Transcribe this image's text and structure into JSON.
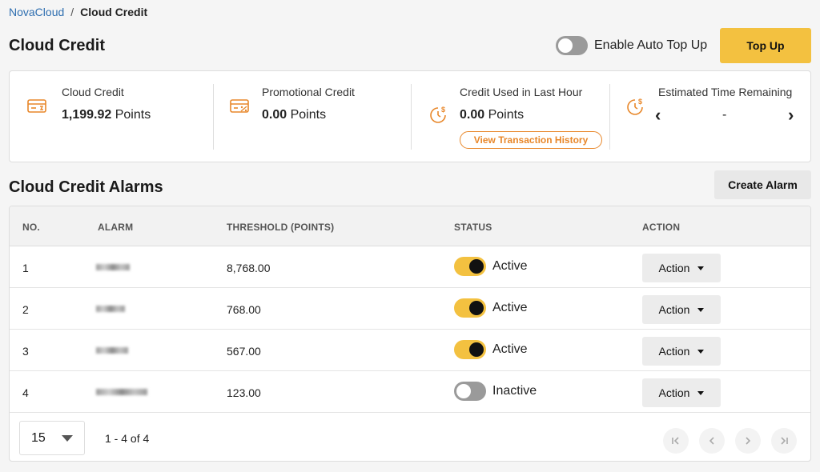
{
  "breadcrumb": {
    "root": "NovaCloud",
    "separator": "/",
    "current": "Cloud Credit"
  },
  "header": {
    "title": "Cloud Credit",
    "auto_topup_label": "Enable Auto Top Up",
    "auto_topup_enabled": false,
    "topup_label": "Top Up"
  },
  "summary": {
    "cloud_credit": {
      "title": "Cloud Credit",
      "amount": "1,199.92",
      "unit": "Points"
    },
    "promotional_credit": {
      "title": "Promotional Credit",
      "amount": "0.00",
      "unit": "Points"
    },
    "credit_used": {
      "title": "Credit Used in Last Hour",
      "amount": "0.00",
      "unit": "Points",
      "link_label": "View Transaction History"
    },
    "time_remaining": {
      "title": "Estimated Time Remaining",
      "value": "-",
      "prev": "‹",
      "next": "›"
    }
  },
  "alarms": {
    "title": "Cloud Credit Alarms",
    "create_label": "Create Alarm",
    "columns": [
      "NO.",
      "ALARM",
      "THRESHOLD (POINTS)",
      "STATUS",
      "ACTION"
    ],
    "rows": [
      {
        "no": "1",
        "threshold": "8,768.00",
        "status": "Active",
        "active": true,
        "action": "Action"
      },
      {
        "no": "2",
        "threshold": "768.00",
        "status": "Active",
        "active": true,
        "action": "Action"
      },
      {
        "no": "3",
        "threshold": "567.00",
        "status": "Active",
        "active": true,
        "action": "Action"
      },
      {
        "no": "4",
        "threshold": "123.00",
        "status": "Inactive",
        "active": false,
        "action": "Action"
      }
    ]
  },
  "pagination": {
    "page_size": "15",
    "range": "1 - 4 of 4"
  },
  "colors": {
    "accent": "#f3c140",
    "link": "#2f6fb0",
    "orange": "#e8872a"
  }
}
